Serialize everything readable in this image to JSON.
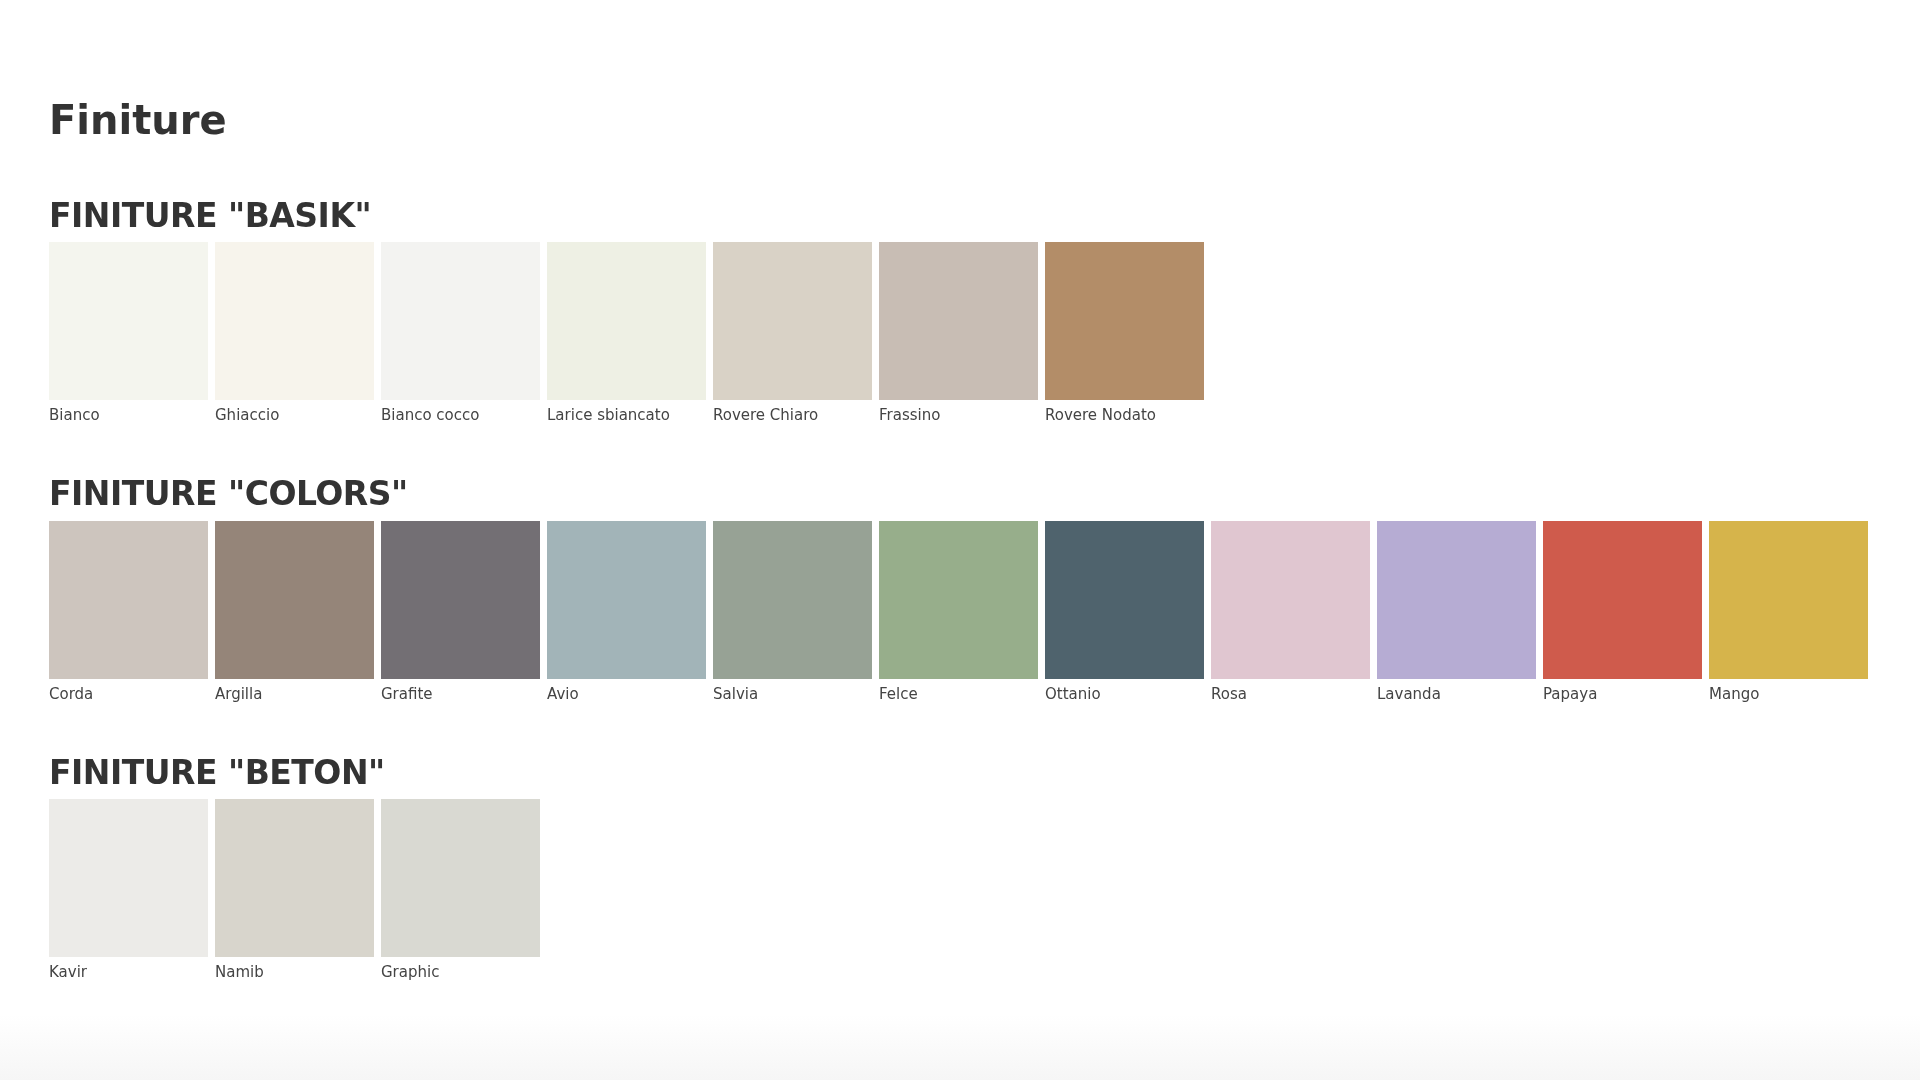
{
  "title": "Finiture",
  "sections": [
    {
      "heading": "FINITURE \"BASIK\"",
      "swatches": [
        {
          "name": "Bianco",
          "color": "#f4f5ee"
        },
        {
          "name": "Ghiaccio",
          "color": "#f7f4ec"
        },
        {
          "name": "Bianco cocco",
          "color": "#f3f3f1"
        },
        {
          "name": "Larice sbiancato",
          "color": "#eef0e4"
        },
        {
          "name": "Rovere Chiaro",
          "color": "#d9d2c6"
        },
        {
          "name": "Frassino",
          "color": "#c8bdb4"
        },
        {
          "name": "Rovere Nodato",
          "color": "#b38d68"
        }
      ]
    },
    {
      "heading": "FINITURE \"COLORS\"",
      "swatches": [
        {
          "name": "Corda",
          "color": "#cdc5be"
        },
        {
          "name": "Argilla",
          "color": "#958579"
        },
        {
          "name": "Grafite",
          "color": "#736f74"
        },
        {
          "name": "Avio",
          "color": "#a2b4b8"
        },
        {
          "name": "Salvia",
          "color": "#97a295"
        },
        {
          "name": "Felce",
          "color": "#97ae8b"
        },
        {
          "name": "Ottanio",
          "color": "#4f636d"
        },
        {
          "name": "Rosa",
          "color": "#e0c6d0"
        },
        {
          "name": "Lavanda",
          "color": "#b6acd3"
        },
        {
          "name": "Papaya",
          "color": "#cf5b4c"
        },
        {
          "name": "Mango",
          "color": "#d6b44b"
        }
      ]
    },
    {
      "heading": "FINITURE \"BETON\"",
      "swatches": [
        {
          "name": "Kavir",
          "color": "#ecebe8"
        },
        {
          "name": "Namib",
          "color": "#d8d5cc"
        },
        {
          "name": "Graphic",
          "color": "#d9d9d2"
        }
      ]
    }
  ]
}
